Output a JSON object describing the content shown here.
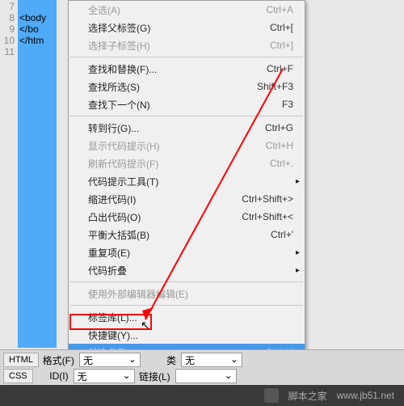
{
  "code_lines": [
    "7",
    "8",
    "9",
    "10",
    "11"
  ],
  "code_text": "\n<body\n</bo\n</htm\n",
  "menu": {
    "select_all": {
      "label": "全选(A)",
      "sc": "Ctrl+A"
    },
    "select_parent": {
      "label": "选择父标签(G)",
      "sc": "Ctrl+["
    },
    "select_child": {
      "label": "选择子标签(H)",
      "sc": "Ctrl+]"
    },
    "find_replace": {
      "label": "查找和替换(F)...",
      "sc": "Ctrl+F"
    },
    "find_sel": {
      "label": "查找所选(S)",
      "sc": "Shift+F3"
    },
    "find_next": {
      "label": "查找下一个(N)",
      "sc": "F3"
    },
    "goto_line": {
      "label": "转到行(G)...",
      "sc": "Ctrl+G"
    },
    "show_hints": {
      "label": "显示代码提示(H)",
      "sc": "Ctrl+H"
    },
    "refresh_hints": {
      "label": "刷新代码提示(F)",
      "sc": "Ctrl+."
    },
    "hint_tools": {
      "label": "代码提示工具(T)"
    },
    "indent": {
      "label": "缩进代码(I)",
      "sc": "Ctrl+Shift+>"
    },
    "outdent": {
      "label": "凸出代码(O)",
      "sc": "Ctrl+Shift+<"
    },
    "balance": {
      "label": "平衡大括弧(B)",
      "sc": "Ctrl+'"
    },
    "repeat": {
      "label": "重复项(E)"
    },
    "fold": {
      "label": "代码折叠"
    },
    "ext_editor": {
      "label": "使用外部编辑器编辑(E)"
    },
    "tag_lib": {
      "label": "标签库(L)..."
    },
    "shortcuts": {
      "label": "快捷键(Y)..."
    },
    "prefs": {
      "label": "首选参数(P)...",
      "sc": "Ctrl+U"
    }
  },
  "toolbar": {
    "tab_html": "HTML",
    "tab_css": "CSS",
    "format_lbl": "格式(F)",
    "format_val": "无",
    "id_lbl": "ID(I)",
    "id_val": "无",
    "class_lbl": "类",
    "class_val": "无",
    "link_lbl": "链接(L)"
  },
  "footer": {
    "site": "脚本之家",
    "url": "www.jb51.net"
  }
}
